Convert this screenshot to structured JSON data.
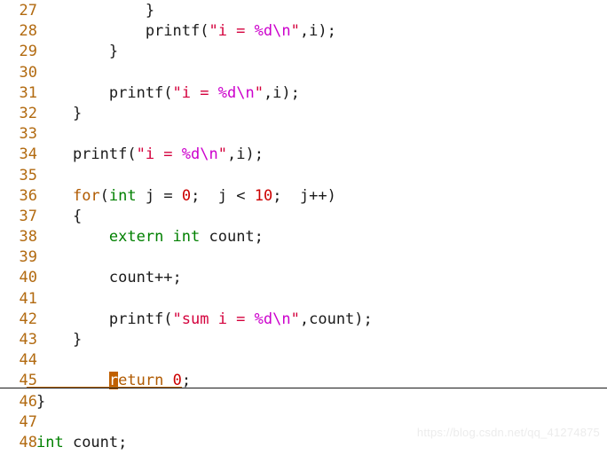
{
  "editor": {
    "first_line_number": 27,
    "colors": {
      "line_number": "#B26A10",
      "keyword": "#008000",
      "control_keyword": "#B05A00",
      "string": "#D4003C",
      "format_specifier": "#CC00CC",
      "number": "#CC0000",
      "plain_text": "#1A1A1A",
      "cursor_block": "#C06000",
      "caret_underline": "#C07010",
      "background": "#FFFFFF",
      "watermark": "#ECECEC"
    },
    "cursor": {
      "line": 45,
      "column": 9,
      "character": "r"
    },
    "lines": [
      {
        "n": "27",
        "tokens": [
          {
            "t": "            }",
            "c": "plain"
          }
        ]
      },
      {
        "n": "28",
        "tokens": [
          {
            "t": "            printf(",
            "c": "plain"
          },
          {
            "t": "\"i = ",
            "c": "str"
          },
          {
            "t": "%d",
            "c": "fmt"
          },
          {
            "t": "\\n",
            "c": "fmt"
          },
          {
            "t": "\"",
            "c": "str"
          },
          {
            "t": ",i);",
            "c": "plain"
          }
        ]
      },
      {
        "n": "29",
        "tokens": [
          {
            "t": "        }",
            "c": "plain"
          }
        ]
      },
      {
        "n": "30",
        "tokens": []
      },
      {
        "n": "31",
        "tokens": [
          {
            "t": "        printf(",
            "c": "plain"
          },
          {
            "t": "\"i = ",
            "c": "str"
          },
          {
            "t": "%d",
            "c": "fmt"
          },
          {
            "t": "\\n",
            "c": "fmt"
          },
          {
            "t": "\"",
            "c": "str"
          },
          {
            "t": ",i);",
            "c": "plain"
          }
        ]
      },
      {
        "n": "32",
        "tokens": [
          {
            "t": "    }",
            "c": "plain"
          }
        ]
      },
      {
        "n": "33",
        "tokens": []
      },
      {
        "n": "34",
        "tokens": [
          {
            "t": "    printf(",
            "c": "plain"
          },
          {
            "t": "\"i = ",
            "c": "str"
          },
          {
            "t": "%d",
            "c": "fmt"
          },
          {
            "t": "\\n",
            "c": "fmt"
          },
          {
            "t": "\"",
            "c": "str"
          },
          {
            "t": ",i);",
            "c": "plain"
          }
        ]
      },
      {
        "n": "35",
        "tokens": []
      },
      {
        "n": "36",
        "tokens": [
          {
            "t": "    ",
            "c": "plain"
          },
          {
            "t": "for",
            "c": "ctl"
          },
          {
            "t": "(",
            "c": "plain"
          },
          {
            "t": "int",
            "c": "kw"
          },
          {
            "t": " j = ",
            "c": "plain"
          },
          {
            "t": "0",
            "c": "num"
          },
          {
            "t": ";  j < ",
            "c": "plain"
          },
          {
            "t": "10",
            "c": "num"
          },
          {
            "t": ";  j++)",
            "c": "plain"
          }
        ]
      },
      {
        "n": "37",
        "tokens": [
          {
            "t": "    {",
            "c": "plain"
          }
        ]
      },
      {
        "n": "38",
        "tokens": [
          {
            "t": "        ",
            "c": "plain"
          },
          {
            "t": "extern int",
            "c": "kw"
          },
          {
            "t": " count;",
            "c": "plain"
          }
        ]
      },
      {
        "n": "39",
        "tokens": []
      },
      {
        "n": "40",
        "tokens": [
          {
            "t": "        count++;",
            "c": "plain"
          }
        ]
      },
      {
        "n": "41",
        "tokens": []
      },
      {
        "n": "42",
        "tokens": [
          {
            "t": "        printf(",
            "c": "plain"
          },
          {
            "t": "\"sum i = ",
            "c": "str"
          },
          {
            "t": "%d",
            "c": "fmt"
          },
          {
            "t": "\\n",
            "c": "fmt"
          },
          {
            "t": "\"",
            "c": "str"
          },
          {
            "t": ",count);",
            "c": "plain"
          }
        ]
      },
      {
        "n": "43",
        "tokens": [
          {
            "t": "    }",
            "c": "plain"
          }
        ]
      },
      {
        "n": "44",
        "tokens": []
      },
      {
        "n": "45",
        "tokens": [
          {
            "t": "        ",
            "c": "plain"
          },
          {
            "t": "r",
            "c": "cursor"
          },
          {
            "t": "eturn",
            "c": "ctl"
          },
          {
            "t": " ",
            "c": "plain"
          },
          {
            "t": "0",
            "c": "num"
          },
          {
            "t": ";",
            "c": "plain"
          }
        ]
      },
      {
        "n": "46",
        "tokens": [
          {
            "t": "}",
            "c": "plain"
          }
        ]
      },
      {
        "n": "47",
        "tokens": []
      },
      {
        "n": "48",
        "tokens": [
          {
            "t": "int",
            "c": "kw"
          },
          {
            "t": " count;",
            "c": "plain"
          }
        ]
      }
    ]
  },
  "watermark": {
    "text": "https://blog.csdn.net/qq_41274875"
  }
}
